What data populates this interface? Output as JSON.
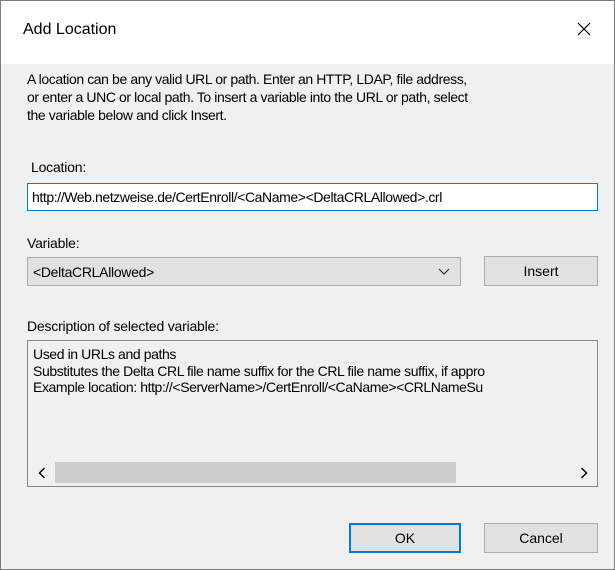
{
  "dialog": {
    "title": "Add Location",
    "intro_lines": [
      "A location can be any valid URL or path. Enter an HTTP, LDAP, file address,",
      "or enter a UNC or local path. To insert a variable into the URL or path, select",
      "the variable below and click Insert."
    ],
    "location": {
      "label": "Location:",
      "value": "http://Web.netzweise.de/CertEnroll/<CaName><DeltaCRLAllowed>.crl"
    },
    "variable": {
      "label": "Variable:",
      "selected": "<DeltaCRLAllowed>"
    },
    "insert_label": "Insert",
    "description": {
      "label": "Description of selected variable:",
      "lines": [
        "Used in URLs and paths",
        "Substitutes the Delta CRL file name suffix for the CRL file name suffix, if appro",
        "Example location: http://<ServerName>/CertEnroll/<CaName><CRLNameSu"
      ],
      "scrollbar": {
        "left_arrow": "chevron-left-icon",
        "right_arrow": "chevron-right-icon"
      }
    },
    "ok_label": "OK",
    "cancel_label": "Cancel",
    "icons": {
      "close": "close-icon",
      "dropdown": "chevron-down-icon"
    },
    "colors": {
      "accent": "#0078d7",
      "dialog_bg": "#f0f0f0",
      "button_bg": "#e1e1e1"
    }
  }
}
